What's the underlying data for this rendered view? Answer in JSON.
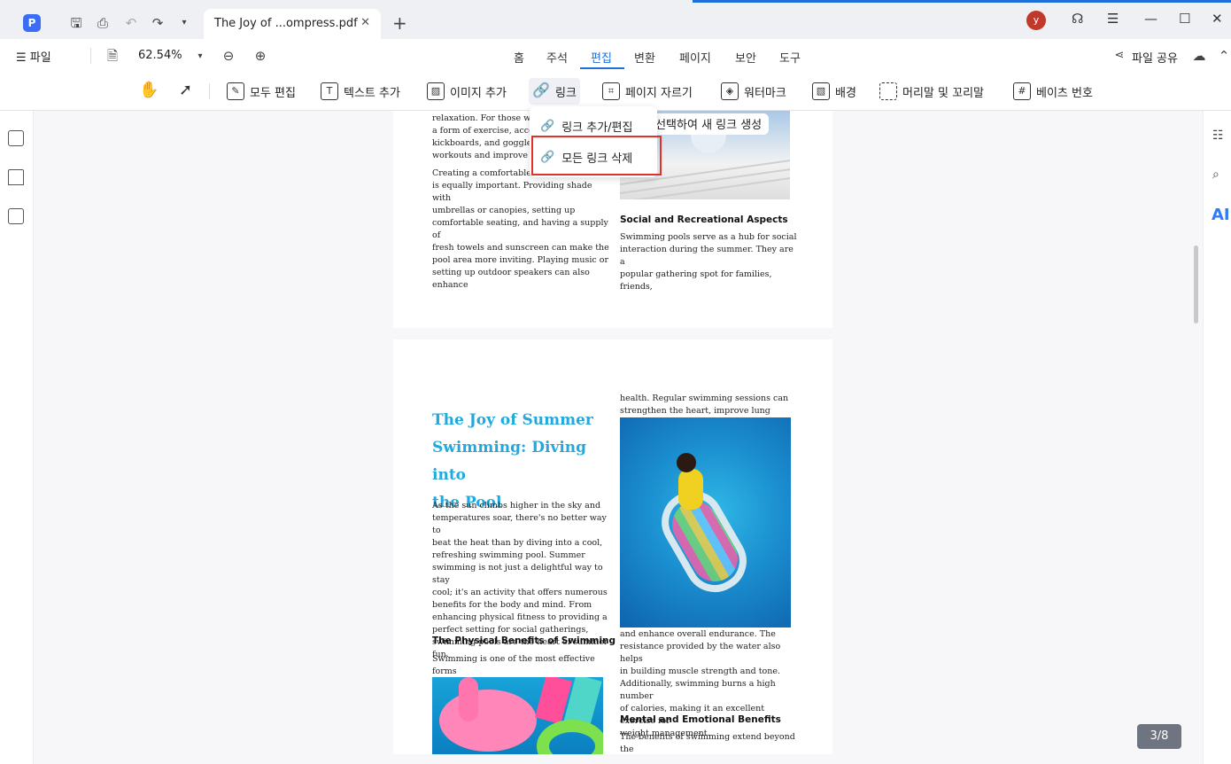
{
  "titlebar": {
    "app_logo": "P",
    "tab_title": "The Joy of ...ompress.pdf",
    "avatar_initial": "y",
    "icons": [
      "save-icon",
      "print-icon",
      "undo-icon",
      "redo-icon",
      "dropdown-icon",
      "close-icon",
      "plus-icon",
      "headset-icon",
      "menu-icon",
      "minimize-icon",
      "maximize-icon",
      "close-window-icon"
    ]
  },
  "menubar": {
    "file_label": "☰ 파일",
    "zoom": "62.54%",
    "tabs": [
      "홈",
      "주석",
      "편집",
      "변환",
      "페이지",
      "보안",
      "도구"
    ],
    "active_tab": "편집",
    "share_label": "파일 공유"
  },
  "toolbar": {
    "edit_all": "모두 편집",
    "add_text": "텍스트 추가",
    "add_image": "이미지 추가",
    "link": "링크",
    "crop": "페이지 자르기",
    "watermark": "워터마크",
    "background": "배경",
    "header_footer": "머리말 및 꼬리말",
    "bates": "베이츠 번호"
  },
  "dropdown": {
    "add_edit_link": "링크 추가/편집",
    "remove_all_links": "모든 링크 삭제"
  },
  "tooltip": "을 선택하여 새 링크 생성",
  "page1": {
    "left_text": "relaxation. For those who\na form of exercise, accesso\nkickboards, and goggles c\nworkouts and improve tec",
    "left_para2": "Creating a comfortable po\nis equally important. Providing shade with\numbrellas or canopies, setting up\ncomfortable seating, and having a supply of\nfresh towels and sunscreen can make the\npool area more inviting. Playing music or\nsetting up outdoor speakers can also enhance",
    "heading": "Social and Recreational Aspects",
    "right_text": "Swimming pools serve as a hub for social\ninteraction during the summer. They are a\npopular gathering spot for families, friends,"
  },
  "page2": {
    "title": "The Joy of Summer\nSwimming: Diving into\nthe Pool",
    "right_top": "health. Regular swimming sessions can\nstrengthen the heart, improve lung capacity,",
    "intro": "As the sun climbs higher in the sky and\ntemperatures soar, there's no better way to\nbeat the heat than by diving into a cool,\nrefreshing swimming pool. Summer\nswimming is not just a delightful way to stay\ncool; it's an activity that offers numerous\nbenefits for the body and mind. From\nenhancing physical fitness to providing a\nperfect setting for social gatherings,\nswimming pools are the heart of summer fun.",
    "heading_physical": "The Physical Benefits of Swimming",
    "physical_text": "Swimming is one of the most effective forms\nof exercise. It's a full-body workout that",
    "right_mid": "and enhance overall endurance. The\nresistance provided by the water also helps\nin building muscle strength and tone.\nAdditionally, swimming burns a high number\nof calories, making it an excellent exercise for\nweight management.",
    "heading_mental": "Mental and Emotional Benefits",
    "mental_text": "The benefits of swimming extend beyond the\nphysical. The rhythmic nature of swimming"
  },
  "page_indicator": "3/8",
  "ai_label": "AI",
  "colors": {
    "accent": "#1e6fd9",
    "title_blue": "#21a9dd",
    "highlight_red": "#e0322b"
  }
}
